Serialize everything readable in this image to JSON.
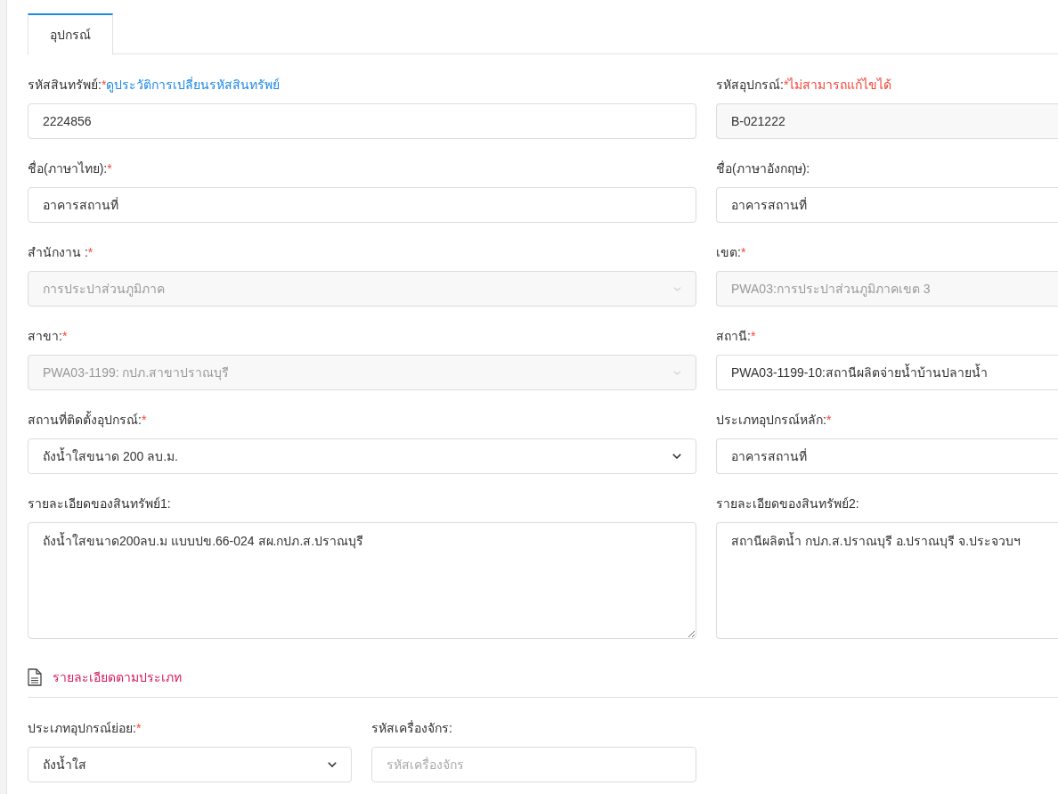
{
  "tabs": [
    {
      "label": "อุปกรณ์",
      "selected": true
    }
  ],
  "fields": [
    {
      "kind": "text",
      "label": "รหัสสินทรัพย์:",
      "required_mark": "*",
      "link": "ดูประวัติการเปลี่ยนรหัสสินทรัพย์",
      "value": "2224856",
      "disabled": false
    },
    {
      "kind": "readonly",
      "label": "รหัสอุปกรณ์:",
      "required_mark": "*",
      "note": "ไม่สามารถแก้ไขได้",
      "value": "B-021222",
      "disabled": false
    },
    {
      "kind": "text",
      "label": "ชื่อ(ภาษาไทย):",
      "required_mark": "*",
      "value": "อาคารสถานที่",
      "disabled": false
    },
    {
      "kind": "text",
      "label": "ชื่อ(ภาษาอังกฤษ):",
      "value": "อาคารสถานที่",
      "disabled": false
    },
    {
      "kind": "select",
      "label": "สำนักงาน :",
      "required_mark": "*",
      "value": "การประปาส่วนภูมิภาค",
      "disabled": true
    },
    {
      "kind": "text",
      "label": "เขต:",
      "required_mark": "*",
      "value": "PWA03:การประปาส่วนภูมิภาคเขต 3",
      "disabled": true
    },
    {
      "kind": "select",
      "label": "สาขา:",
      "required_mark": "*",
      "value": "PWA03-1199: กปภ.สาขาปราณบุรี",
      "disabled": true
    },
    {
      "kind": "text",
      "label": "สถานี:",
      "required_mark": "*",
      "value": "PWA03-1199-10:สถานีผลิตจ่ายน้ำบ้านปลายน้ำ",
      "disabled": false
    },
    {
      "kind": "select",
      "label": "สถานที่ติดตั้งอุปกรณ์:",
      "required_mark": "*",
      "value": "ถังน้ำใสขนาด 200 ลบ.ม.",
      "disabled": false
    },
    {
      "kind": "text",
      "label": "ประเภทอุปกรณ์หลัก:",
      "required_mark": "*",
      "value": "อาคารสถานที่",
      "disabled": false
    },
    {
      "kind": "textarea",
      "label": "รายละเอียดของสินทรัพย์1:",
      "value": "ถังน้ำใสขนาด200ลบ.ม แบบปข.66-024 สผ.กปภ.ส.ปราณบุรี",
      "disabled": false
    },
    {
      "kind": "textarea",
      "label": "รายละเอียดของสินทรัพย์2:",
      "value": "สถานีผลิตน้ำ กปภ.ส.ปราณบุรี อ.ปราณบุรี จ.ประจวบฯ",
      "disabled": false
    }
  ],
  "section": {
    "title": "รายละเอียดตามประเภท",
    "fields": [
      {
        "kind": "select",
        "label": "ประเภทอุปกรณ์ย่อย:",
        "required_mark": "*",
        "value": "ถังน้ำใส",
        "disabled": false
      },
      {
        "kind": "text",
        "label": "รหัสเครื่องจักร:",
        "placeholder": "รหัสเครื่องจักร"
      }
    ]
  }
}
